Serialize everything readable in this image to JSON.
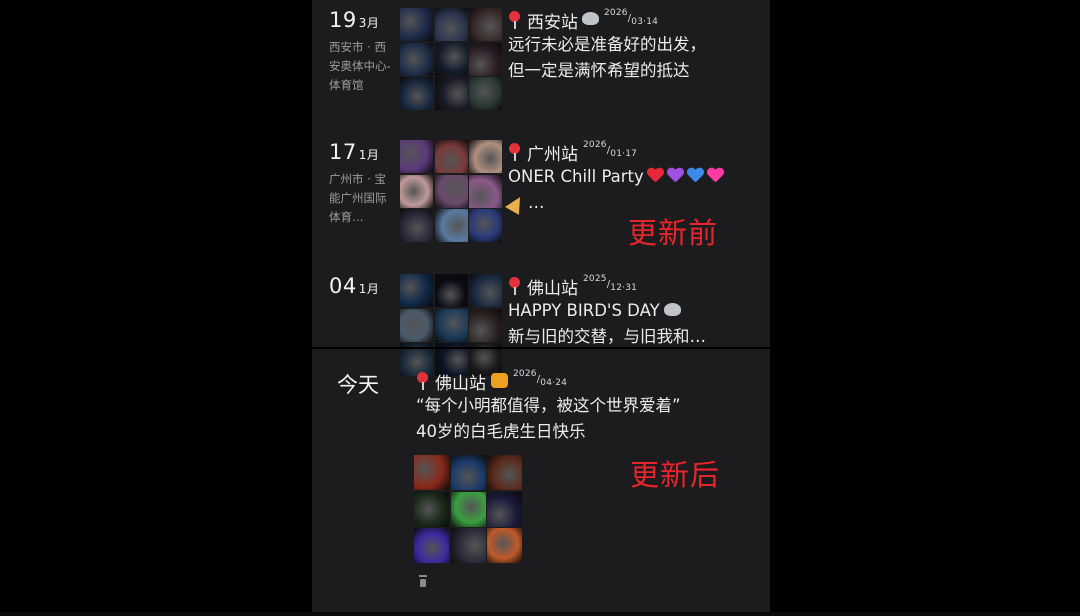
{
  "entries_before": [
    {
      "day": "19",
      "month": "3月",
      "location": "西安市 · 西安奥体中心-体育馆",
      "station": "西安站",
      "date_year": "2026",
      "date_rest": "03·14",
      "lines": [
        "远行未必是准备好的出发，",
        "但一定是满怀希望的抵达"
      ],
      "photo_colors": [
        "#1d2a4a",
        "#2a3550",
        "#3a2a2a",
        "#20304a",
        "#141c2c",
        "#2a1c24",
        "#18283e",
        "#1a1a26",
        "#2c3a34"
      ]
    },
    {
      "day": "17",
      "month": "1月",
      "location": "广州市 · 宝能广州国际体育…",
      "station": "广州站",
      "date_year": "2026",
      "date_rest": "01·17",
      "lines": [
        "ONER Chill Party",
        "…"
      ],
      "photo_colors": [
        "#5a3a7a",
        "#7a3a3a",
        "#b09080",
        "#c09a9a",
        "#6a4a6a",
        "#8a5a8a",
        "#2a2a3a",
        "#5a7aa0",
        "#2a3a7a"
      ]
    },
    {
      "day": "04",
      "month": "1月",
      "location": "",
      "station": "佛山站",
      "date_year": "2025",
      "date_rest": "12·31",
      "lines": [
        "HAPPY BIRD'S DAY",
        "新与旧的交替，与旧我和…"
      ],
      "photo_colors": [
        "#102848",
        "#0a0a14",
        "#1a2a40",
        "#4a5a6a",
        "#1a3a5a",
        "#2a2020",
        "#1a2a3a",
        "#0a1424",
        "#1a1a1a"
      ]
    }
  ],
  "entry_after": {
    "today_label": "今天",
    "station": "佛山站",
    "date_year": "2026",
    "date_rest": "04·24",
    "lines": [
      "“每个小明都值得，被这个世界爱着”",
      "40岁的白毛虎生日快乐"
    ],
    "photo_colors": [
      "#8a2a1a",
      "#1a3a6a",
      "#5a2a1a",
      "#1a2a1a",
      "#3aa040",
      "#1a1a3a",
      "#3a2aa0",
      "#2a2a3a",
      "#c05a2a"
    ]
  },
  "labels": {
    "before": "更新前",
    "after": "更新后"
  },
  "icons": {
    "pin": "location-pin-icon",
    "party": "party-popper-icon",
    "tiger": "tiger-face-icon"
  },
  "heart_colors": [
    "#e8283a",
    "#a050e0",
    "#3a8ae8",
    "#ff3aa0"
  ]
}
